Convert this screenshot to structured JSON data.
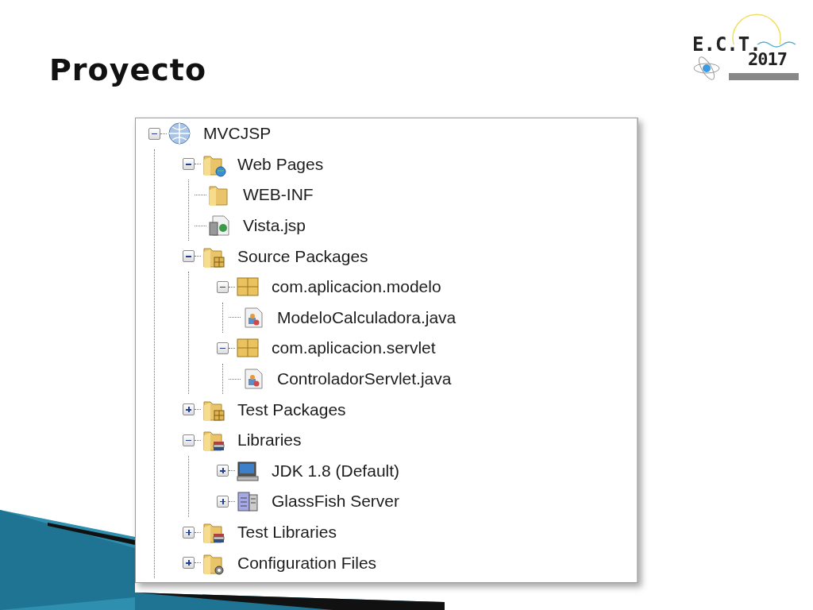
{
  "slide": {
    "title": "Proyecto"
  },
  "logo": {
    "title": "E.C.T.",
    "year": "2017"
  },
  "tree": {
    "nodes": [
      {
        "label": "MVCJSP",
        "kind": "project",
        "expanded": true,
        "children": [
          {
            "label": "Web Pages",
            "kind": "webfolder",
            "expanded": true,
            "children": [
              {
                "label": "WEB-INF",
                "kind": "folder"
              },
              {
                "label": "Vista.jsp",
                "kind": "jsp"
              }
            ]
          },
          {
            "label": "Source Packages",
            "kind": "pkgfolder",
            "expanded": true,
            "children": [
              {
                "label": "com.aplicacion.modelo",
                "kind": "package",
                "expanded": true,
                "children": [
                  {
                    "label": "ModeloCalculadora.java",
                    "kind": "java"
                  }
                ]
              },
              {
                "label": "com.aplicacion.servlet",
                "kind": "package",
                "expanded": true,
                "children": [
                  {
                    "label": "ControladorServlet.java",
                    "kind": "java"
                  }
                ]
              }
            ]
          },
          {
            "label": "Test Packages",
            "kind": "pkgfolder",
            "expanded": false
          },
          {
            "label": "Libraries",
            "kind": "libfolder",
            "expanded": true,
            "children": [
              {
                "label": "JDK 1.8 (Default)",
                "kind": "jdk",
                "expanded": false
              },
              {
                "label": "GlassFish Server",
                "kind": "server",
                "expanded": false
              }
            ]
          },
          {
            "label": "Test Libraries",
            "kind": "libfolder",
            "expanded": false
          },
          {
            "label": "Configuration Files",
            "kind": "configfolder",
            "expanded": false
          }
        ]
      }
    ]
  }
}
